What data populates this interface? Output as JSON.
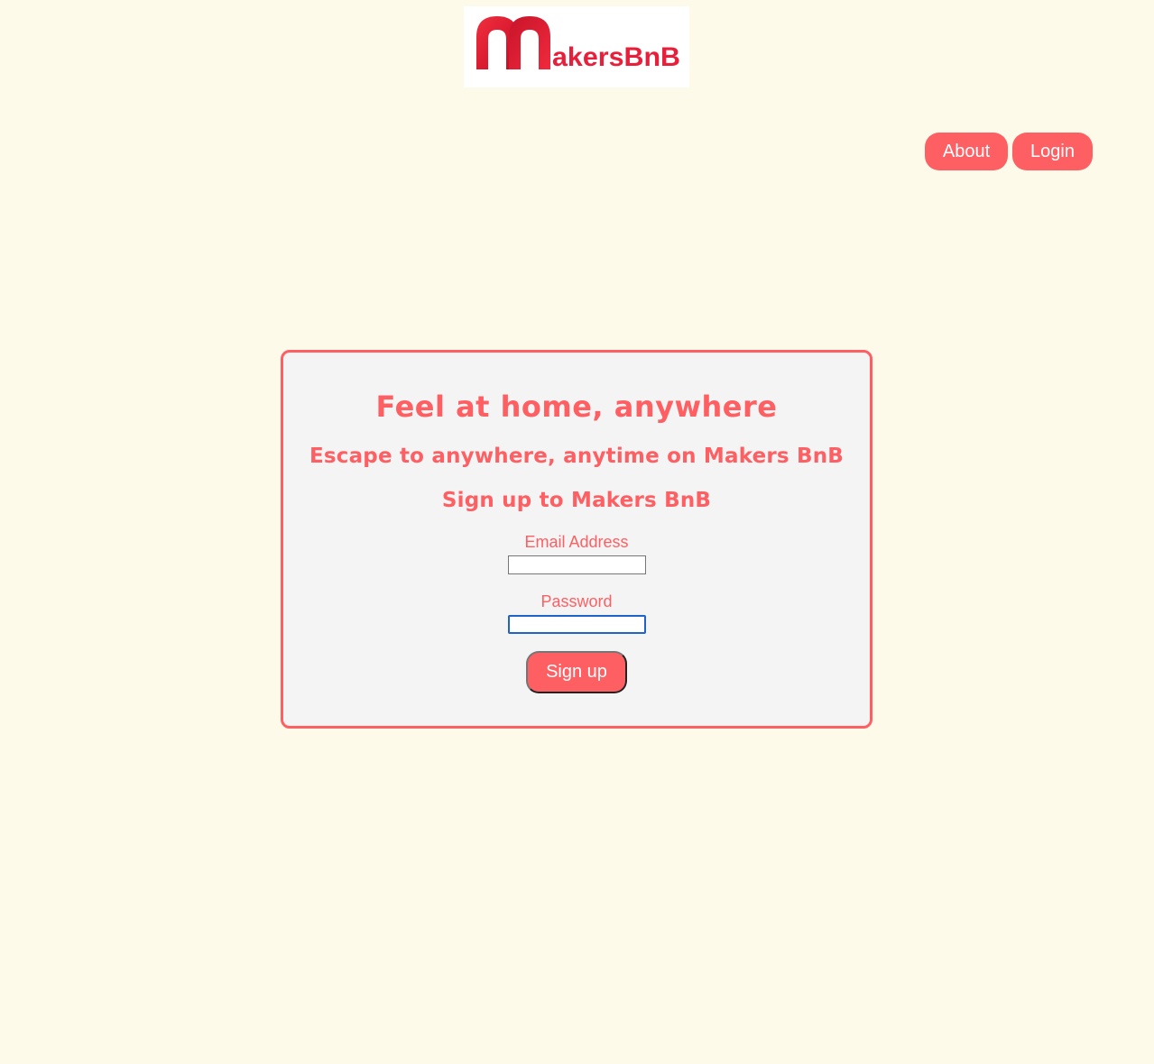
{
  "logo": {
    "text": "akersBnB",
    "alt": "MakersBnB"
  },
  "nav": {
    "about_label": "About",
    "login_label": "Login"
  },
  "card": {
    "title": "Feel at home, anywhere",
    "subtitle": "Escape to anywhere, anytime on Makers BnB",
    "form_heading": "Sign up to Makers BnB",
    "email_label": "Email Address",
    "email_value": "",
    "password_label": "Password",
    "password_value": "",
    "submit_label": "Sign up"
  },
  "colors": {
    "background": "#fefae9",
    "accent": "#fe5f63",
    "card_background": "#f4f4f4",
    "logo_red": "#e81f3a",
    "focus_ring": "#1d63c9"
  }
}
